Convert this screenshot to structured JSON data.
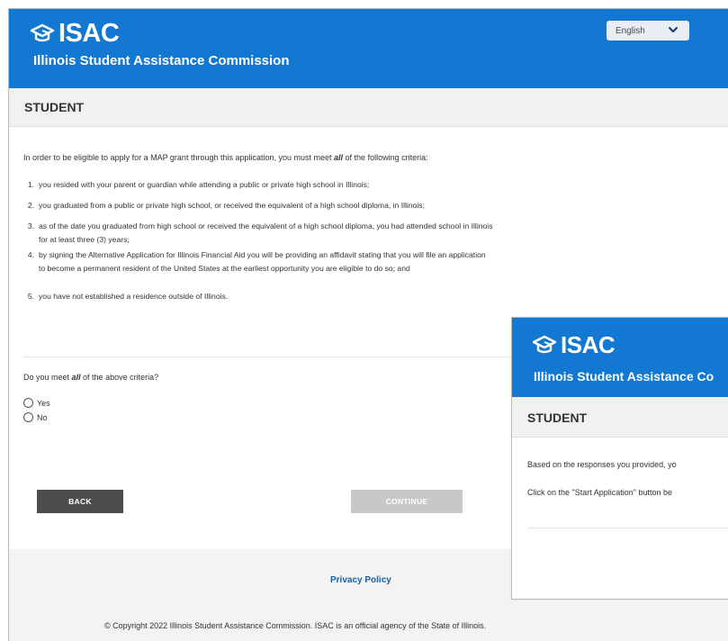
{
  "header": {
    "logo_text": "ISAC",
    "org_name": "Illinois Student Assistance Commission",
    "language": "English"
  },
  "section": {
    "title": "STUDENT"
  },
  "intro": {
    "pre": "In order to be eligible to apply for a MAP grant through this application, you must meet ",
    "emph": "all",
    "post": " of the following criteria:"
  },
  "criteria": [
    {
      "num": "1.",
      "lines": [
        "you resided with your parent or guardian while attending a public or private high school in Illinois;"
      ]
    },
    {
      "num": "2.",
      "lines": [
        "you graduated from a public or private high school, or received the equivalent of a high school diploma, in Illinois;"
      ]
    },
    {
      "num": "3.",
      "lines": [
        "as of the date you graduated from high school or received the equivalent of a high school diploma, you had attended school in Illinois",
        "for at least three (3) years;"
      ]
    },
    {
      "num": "4.",
      "lines": [
        "by signing the Alternative Application for Illinois Financial Aid you will be providing an affidavit stating that you will file an application",
        "to become a permanent resident of the United States at the earliest opportunity you are eligible to do so; and"
      ]
    },
    {
      "num": "5.",
      "lines": [
        "you have not established a residence outside of Illinois."
      ]
    }
  ],
  "question": {
    "pre": "Do you meet ",
    "emph": "all",
    "post": " of the above criteria?"
  },
  "options": {
    "yes": "Yes",
    "no": "No"
  },
  "buttons": {
    "back": "BACK",
    "continue": "CONTINUE"
  },
  "footer": {
    "privacy": "Privacy Policy",
    "copyright": "© Copyright 2022 Illinois Student Assistance Commission. ISAC is an official agency of the State of Illinois."
  },
  "overlay": {
    "logo_text": "ISAC",
    "org_name": "Illinois Student Assistance Co",
    "title": "STUDENT",
    "line1": "Based on the responses you provided, yo",
    "line2": "Click on the \"Start Application\" button be"
  },
  "colors": {
    "brand_blue": "#1378d1",
    "back_button": "#4d4d4d",
    "continue_disabled": "#c8c8c8",
    "link": "#1b5fa8"
  }
}
